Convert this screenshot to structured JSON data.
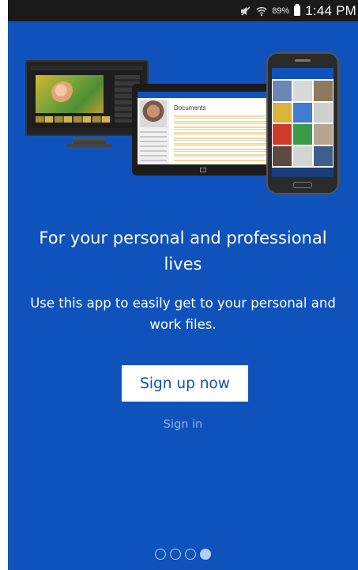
{
  "status_bar": {
    "battery_percent": "89%",
    "time": "1:44 PM",
    "icons": [
      "mute-icon",
      "wifi-icon",
      "battery-icon"
    ]
  },
  "hero": {
    "tablet_title": "Documents"
  },
  "onboarding": {
    "heading": "For your personal and professional lives",
    "description": "Use this app to easily get to your personal and work files.",
    "signup_label": "Sign up now",
    "signin_label": "Sign in",
    "page_count": 4,
    "active_page": 4
  },
  "colors": {
    "background": "#0f52bc",
    "button_bg": "#ffffff",
    "button_text": "#0e4fb8",
    "signin_text": "#8eb2e8"
  }
}
